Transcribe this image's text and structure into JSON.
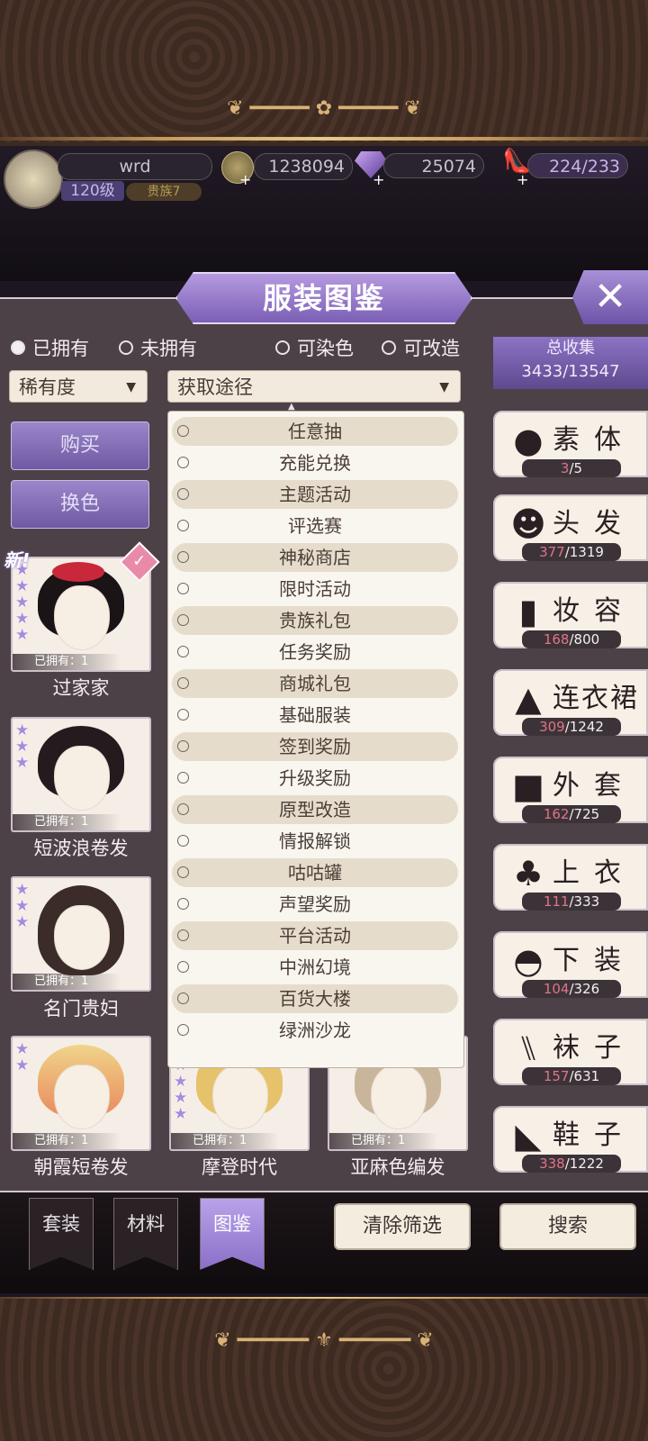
{
  "header": {
    "player_name": "wrd",
    "level": "120级",
    "rank": "贵族7",
    "gold": "1238094",
    "diamonds": "25074",
    "stamina": "224/233"
  },
  "panel": {
    "title": "服装图鉴",
    "close_icon": "close-x-icon"
  },
  "filters": {
    "owned_label": "已拥有",
    "not_owned_label": "未拥有",
    "dyeable_label": "可染色",
    "modifiable_label": "可改造",
    "rarity_label": "稀有度",
    "source_label": "获取途径"
  },
  "side_buttons": {
    "buy": "购买",
    "recolor": "换色"
  },
  "new_tag": "新!",
  "items": [
    {
      "name": "过家家",
      "owned": "已拥有：1"
    },
    {
      "name": "短波浪卷发",
      "owned": "已拥有：1"
    },
    {
      "name": "名门贵妇",
      "owned": "已拥有：1"
    },
    {
      "name": "朝霞短卷发",
      "owned": "已拥有：1"
    },
    {
      "name": "摩登时代",
      "owned": "已拥有：1"
    },
    {
      "name": "亚麻色编发",
      "owned": "已拥有：1"
    }
  ],
  "source_options": [
    "任意抽",
    "充能兑换",
    "主题活动",
    "评选赛",
    "神秘商店",
    "限时活动",
    "贵族礼包",
    "任务奖励",
    "商城礼包",
    "基础服装",
    "签到奖励",
    "升级奖励",
    "原型改造",
    "情报解锁",
    "咕咕罐",
    "声望奖励",
    "平台活动",
    "中洲幻境",
    "百货大楼",
    "绿洲沙龙"
  ],
  "collection": {
    "total_label": "总收集",
    "total_value": "3433/13547",
    "categories": [
      {
        "label": "素体",
        "have": "3",
        "total": "/5",
        "icon": "body-silhouette-icon"
      },
      {
        "label": "头发",
        "have": "377",
        "total": "/1319",
        "icon": "hair-icon"
      },
      {
        "label": "妆容",
        "have": "168",
        "total": "/800",
        "icon": "lipstick-icon"
      },
      {
        "label": "连衣裙",
        "have": "309",
        "total": "/1242",
        "icon": "dress-icon"
      },
      {
        "label": "外套",
        "have": "162",
        "total": "/725",
        "icon": "coat-icon"
      },
      {
        "label": "上衣",
        "have": "111",
        "total": "/333",
        "icon": "top-icon"
      },
      {
        "label": "下装",
        "have": "104",
        "total": "/326",
        "icon": "skirt-icon"
      },
      {
        "label": "袜子",
        "have": "157",
        "total": "/631",
        "icon": "socks-icon"
      },
      {
        "label": "鞋子",
        "have": "338",
        "total": "/1222",
        "icon": "high-heel-icon"
      }
    ]
  },
  "bottom_tabs": [
    "套装",
    "材料",
    "图鉴"
  ],
  "bottom_buttons": {
    "clear": "清除筛选",
    "search": "搜索"
  }
}
